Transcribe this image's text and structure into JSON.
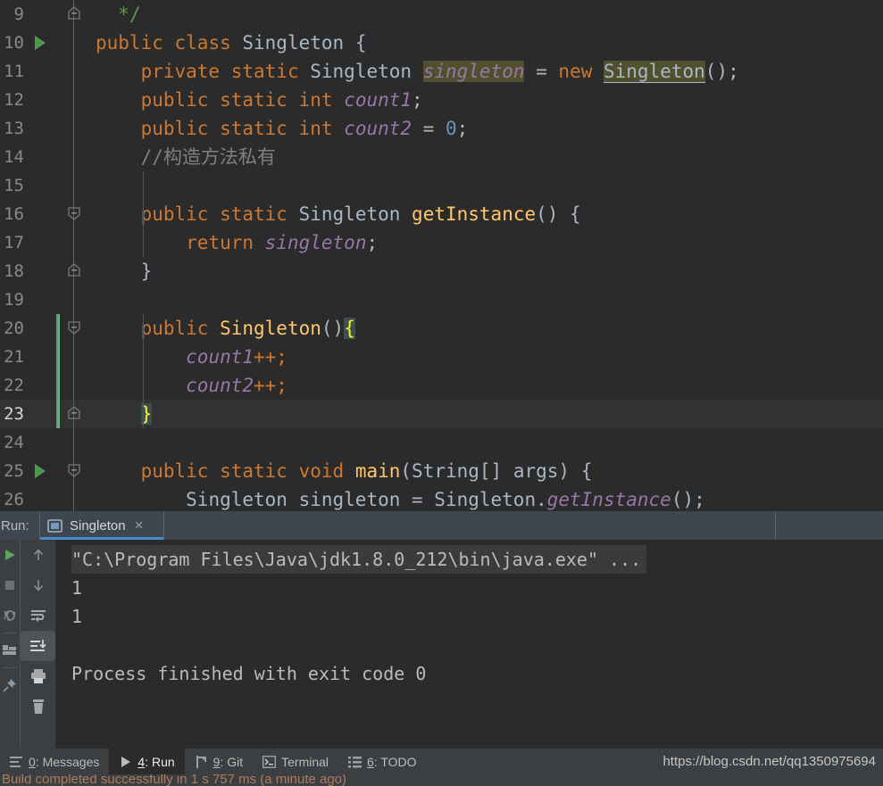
{
  "editor": {
    "language": "java",
    "colors": {
      "background": "#2B2B2B",
      "current_line": "#323232",
      "keyword": "#CC7832",
      "field": "#9876AA",
      "method": "#FFC66D",
      "number": "#6897BB",
      "comment": "#808080",
      "doc_comment": "#629755",
      "identifier": "#A9B7C6",
      "search_highlight": "#50502F",
      "brace_match_bg": "#3B514D",
      "brace_match_fg": "#FFEF28",
      "run_marker": "#4B9B4B"
    },
    "lines": [
      {
        "number": "9",
        "run_marker": false,
        "fold": "end-top",
        "changed": false,
        "current": false,
        "tokens": [
          {
            "t": "  ",
            "c": "pun"
          },
          {
            "t": "*/",
            "c": "cmtg"
          }
        ]
      },
      {
        "number": "10",
        "run_marker": true,
        "fold": "line",
        "changed": false,
        "current": false,
        "tokens": [
          {
            "t": "public ",
            "c": "kw"
          },
          {
            "t": "class ",
            "c": "kw"
          },
          {
            "t": "Singleton ",
            "c": "cls"
          },
          {
            "t": "{",
            "c": "pun"
          }
        ]
      },
      {
        "number": "11",
        "run_marker": false,
        "fold": "line",
        "changed": false,
        "current": false,
        "tokens": [
          {
            "t": "    ",
            "c": "pun"
          },
          {
            "t": "private ",
            "c": "kw"
          },
          {
            "t": "static ",
            "c": "kw"
          },
          {
            "t": "Singleton ",
            "c": "cls"
          },
          {
            "t": "singleton",
            "c": "fldhl"
          },
          {
            "t": " = ",
            "c": "pun"
          },
          {
            "t": "new ",
            "c": "kw"
          },
          {
            "t": "Singleton",
            "c": "clshl"
          },
          {
            "t": "();",
            "c": "pun"
          }
        ]
      },
      {
        "number": "12",
        "run_marker": false,
        "fold": "line",
        "changed": false,
        "current": false,
        "tokens": [
          {
            "t": "    ",
            "c": "pun"
          },
          {
            "t": "public ",
            "c": "kw"
          },
          {
            "t": "static ",
            "c": "kw"
          },
          {
            "t": "int ",
            "c": "kw"
          },
          {
            "t": "count1",
            "c": "fld"
          },
          {
            "t": ";",
            "c": "pun"
          }
        ]
      },
      {
        "number": "13",
        "run_marker": false,
        "fold": "line",
        "changed": false,
        "current": false,
        "tokens": [
          {
            "t": "    ",
            "c": "pun"
          },
          {
            "t": "public ",
            "c": "kw"
          },
          {
            "t": "static ",
            "c": "kw"
          },
          {
            "t": "int ",
            "c": "kw"
          },
          {
            "t": "count2",
            "c": "fld"
          },
          {
            "t": " = ",
            "c": "pun"
          },
          {
            "t": "0",
            "c": "num"
          },
          {
            "t": ";",
            "c": "pun"
          }
        ]
      },
      {
        "number": "14",
        "run_marker": false,
        "fold": "line",
        "changed": false,
        "current": false,
        "tokens": [
          {
            "t": "    ",
            "c": "pun"
          },
          {
            "t": "//构造方法私有",
            "c": "cmt"
          }
        ]
      },
      {
        "number": "15",
        "run_marker": false,
        "fold": "line",
        "changed": false,
        "current": false,
        "tokens": []
      },
      {
        "number": "16",
        "run_marker": false,
        "fold": "start",
        "changed": false,
        "current": false,
        "tokens": [
          {
            "t": "    ",
            "c": "pun"
          },
          {
            "t": "public ",
            "c": "kw"
          },
          {
            "t": "static ",
            "c": "kw"
          },
          {
            "t": "Singleton ",
            "c": "cls"
          },
          {
            "t": "getInstance",
            "c": "mtd"
          },
          {
            "t": "() {",
            "c": "pun"
          }
        ]
      },
      {
        "number": "17",
        "run_marker": false,
        "fold": "line",
        "changed": false,
        "current": false,
        "tokens": [
          {
            "t": "        ",
            "c": "pun"
          },
          {
            "t": "return ",
            "c": "kw"
          },
          {
            "t": "singleton",
            "c": "fld"
          },
          {
            "t": ";",
            "c": "pun"
          }
        ]
      },
      {
        "number": "18",
        "run_marker": false,
        "fold": "end-top",
        "changed": false,
        "current": false,
        "tokens": [
          {
            "t": "    ",
            "c": "pun"
          },
          {
            "t": "}",
            "c": "pun"
          }
        ]
      },
      {
        "number": "19",
        "run_marker": false,
        "fold": "line",
        "changed": false,
        "current": false,
        "tokens": []
      },
      {
        "number": "20",
        "run_marker": false,
        "fold": "start",
        "changed": true,
        "current": false,
        "tokens": [
          {
            "t": "    ",
            "c": "pun"
          },
          {
            "t": "public ",
            "c": "kw"
          },
          {
            "t": "Singleton",
            "c": "mtd"
          },
          {
            "t": "()",
            "c": "pun"
          },
          {
            "t": "{",
            "c": "brch"
          }
        ]
      },
      {
        "number": "21",
        "run_marker": false,
        "fold": "line",
        "changed": true,
        "current": false,
        "tokens": [
          {
            "t": "        ",
            "c": "pun"
          },
          {
            "t": "count1",
            "c": "fld"
          },
          {
            "t": "++;",
            "c": "kw"
          }
        ]
      },
      {
        "number": "22",
        "run_marker": false,
        "fold": "line",
        "changed": true,
        "current": false,
        "tokens": [
          {
            "t": "        ",
            "c": "pun"
          },
          {
            "t": "count2",
            "c": "fld"
          },
          {
            "t": "++;",
            "c": "kw"
          }
        ]
      },
      {
        "number": "23",
        "run_marker": false,
        "fold": "end-top",
        "changed": true,
        "current": true,
        "tokens": [
          {
            "t": "    ",
            "c": "pun"
          },
          {
            "t": "}",
            "c": "brch"
          }
        ]
      },
      {
        "number": "24",
        "run_marker": false,
        "fold": "line",
        "changed": false,
        "current": false,
        "tokens": []
      },
      {
        "number": "25",
        "run_marker": true,
        "fold": "start",
        "changed": false,
        "current": false,
        "tokens": [
          {
            "t": "    ",
            "c": "pun"
          },
          {
            "t": "public ",
            "c": "kw"
          },
          {
            "t": "static ",
            "c": "kw"
          },
          {
            "t": "void ",
            "c": "kw"
          },
          {
            "t": "main",
            "c": "mtd"
          },
          {
            "t": "(String[] args) {",
            "c": "pun"
          }
        ]
      },
      {
        "number": "26",
        "run_marker": false,
        "fold": "line",
        "changed": false,
        "current": false,
        "tokens": [
          {
            "t": "        ",
            "c": "pun"
          },
          {
            "t": "Singleton singleton = Singleton.",
            "c": "cls"
          },
          {
            "t": "getInstance",
            "c": "fld"
          },
          {
            "t": "();",
            "c": "pun"
          }
        ]
      }
    ]
  },
  "run_window": {
    "label": "Run:",
    "tab": {
      "name": "Singleton",
      "icon": "run-configuration-icon",
      "close": "×"
    },
    "toolbar_left": [
      {
        "name": "rerun-button",
        "icon": "play-icon"
      },
      {
        "name": "stop-button",
        "icon": "stop-icon"
      },
      {
        "name": "rerun-failed-tests-button",
        "icon": "rerun-failed-icon"
      },
      {
        "name": "layout-settings-button",
        "icon": "layout-icon"
      },
      {
        "name": "pin-tab-button",
        "icon": "pin-icon"
      }
    ],
    "toolbar_right": [
      {
        "name": "up-stack-trace-button",
        "icon": "arrow-up-icon"
      },
      {
        "name": "down-stack-trace-button",
        "icon": "arrow-down-icon"
      },
      {
        "name": "soft-wrap-button",
        "icon": "soft-wrap-icon"
      },
      {
        "name": "scroll-to-end-button",
        "icon": "scroll-to-end-icon",
        "selected": true
      },
      {
        "name": "print-button",
        "icon": "printer-icon"
      },
      {
        "name": "clear-all-button",
        "icon": "trash-icon"
      }
    ],
    "console": [
      {
        "text": "\"C:\\Program Files\\Java\\jdk1.8.0_212\\bin\\java.exe\" ...",
        "highlight": true
      },
      {
        "text": "1",
        "highlight": false
      },
      {
        "text": "1",
        "highlight": false
      },
      {
        "text": "",
        "highlight": false
      },
      {
        "text": "Process finished with exit code 0",
        "highlight": false
      }
    ]
  },
  "tool_window_bar": {
    "items": [
      {
        "key": "0",
        "label": ": Messages",
        "icon": "messages-icon",
        "active": false
      },
      {
        "key": "4",
        "label": ": Run",
        "icon": "run-icon",
        "active": true
      },
      {
        "key": "9",
        "label": ": Git",
        "icon": "git-branch-icon",
        "active": false
      },
      {
        "key": "",
        "label": "Terminal",
        "icon": "terminal-icon",
        "active": false
      },
      {
        "key": "6",
        "label": ": TODO",
        "icon": "todo-icon",
        "active": false
      }
    ],
    "watermark": "https://blog.csdn.net/qq1350975694"
  },
  "status_bar": {
    "message": "Build completed successfully in 1 s 757 ms (a minute ago)"
  }
}
